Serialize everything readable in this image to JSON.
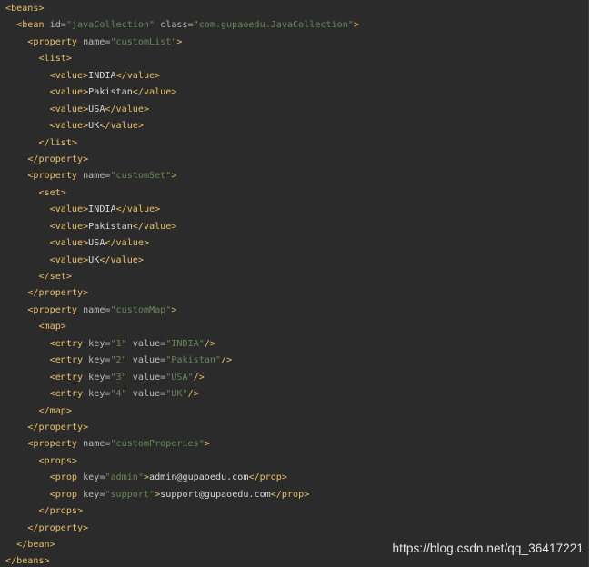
{
  "code_lines": [
    {
      "indent": 0,
      "tokens": [
        {
          "t": "tag",
          "v": "<beans>"
        }
      ]
    },
    {
      "indent": 1,
      "tokens": [
        {
          "t": "tag",
          "v": "<bean "
        },
        {
          "t": "attr",
          "v": "id="
        },
        {
          "t": "val",
          "v": "\"javaCollection\""
        },
        {
          "t": "attr",
          "v": " class="
        },
        {
          "t": "val",
          "v": "\"com.gupaoedu.JavaCollection\""
        },
        {
          "t": "tag",
          "v": ">"
        }
      ]
    },
    {
      "indent": 2,
      "tokens": [
        {
          "t": "tag",
          "v": "<property "
        },
        {
          "t": "attr",
          "v": "name="
        },
        {
          "t": "val",
          "v": "\"customList\""
        },
        {
          "t": "tag",
          "v": ">"
        }
      ]
    },
    {
      "indent": 3,
      "tokens": [
        {
          "t": "tag",
          "v": "<list>"
        }
      ]
    },
    {
      "indent": 4,
      "tokens": [
        {
          "t": "tag",
          "v": "<value>"
        },
        {
          "t": "txt",
          "v": "INDIA"
        },
        {
          "t": "tag",
          "v": "</value>"
        }
      ]
    },
    {
      "indent": 4,
      "tokens": [
        {
          "t": "tag",
          "v": "<value>"
        },
        {
          "t": "txt",
          "v": "Pakistan"
        },
        {
          "t": "tag",
          "v": "</value>"
        }
      ]
    },
    {
      "indent": 4,
      "tokens": [
        {
          "t": "tag",
          "v": "<value>"
        },
        {
          "t": "txt",
          "v": "USA"
        },
        {
          "t": "tag",
          "v": "</value>"
        }
      ]
    },
    {
      "indent": 4,
      "tokens": [
        {
          "t": "tag",
          "v": "<value>"
        },
        {
          "t": "txt",
          "v": "UK"
        },
        {
          "t": "tag",
          "v": "</value>"
        }
      ]
    },
    {
      "indent": 3,
      "tokens": [
        {
          "t": "tag",
          "v": "</list>"
        }
      ]
    },
    {
      "indent": 2,
      "tokens": [
        {
          "t": "tag",
          "v": "</property>"
        }
      ]
    },
    {
      "indent": 2,
      "tokens": [
        {
          "t": "tag",
          "v": "<property "
        },
        {
          "t": "attr",
          "v": "name="
        },
        {
          "t": "val",
          "v": "\"customSet\""
        },
        {
          "t": "tag",
          "v": ">"
        }
      ]
    },
    {
      "indent": 3,
      "tokens": [
        {
          "t": "tag",
          "v": "<set>"
        }
      ]
    },
    {
      "indent": 4,
      "tokens": [
        {
          "t": "tag",
          "v": "<value>"
        },
        {
          "t": "txt",
          "v": "INDIA"
        },
        {
          "t": "tag",
          "v": "</value>"
        }
      ]
    },
    {
      "indent": 4,
      "tokens": [
        {
          "t": "tag",
          "v": "<value>"
        },
        {
          "t": "txt",
          "v": "Pakistan"
        },
        {
          "t": "tag",
          "v": "</value>"
        }
      ]
    },
    {
      "indent": 4,
      "tokens": [
        {
          "t": "tag",
          "v": "<value>"
        },
        {
          "t": "txt",
          "v": "USA"
        },
        {
          "t": "tag",
          "v": "</value>"
        }
      ]
    },
    {
      "indent": 4,
      "tokens": [
        {
          "t": "tag",
          "v": "<value>"
        },
        {
          "t": "txt",
          "v": "UK"
        },
        {
          "t": "tag",
          "v": "</value>"
        }
      ]
    },
    {
      "indent": 3,
      "tokens": [
        {
          "t": "tag",
          "v": "</set>"
        }
      ]
    },
    {
      "indent": 2,
      "tokens": [
        {
          "t": "tag",
          "v": "</property>"
        }
      ]
    },
    {
      "indent": 2,
      "tokens": [
        {
          "t": "tag",
          "v": "<property "
        },
        {
          "t": "attr",
          "v": "name="
        },
        {
          "t": "val",
          "v": "\"customMap\""
        },
        {
          "t": "tag",
          "v": ">"
        }
      ]
    },
    {
      "indent": 3,
      "tokens": [
        {
          "t": "tag",
          "v": "<map>"
        }
      ]
    },
    {
      "indent": 4,
      "tokens": [
        {
          "t": "tag",
          "v": "<entry "
        },
        {
          "t": "attr",
          "v": "key="
        },
        {
          "t": "val",
          "v": "\"1\""
        },
        {
          "t": "attr",
          "v": " value="
        },
        {
          "t": "val",
          "v": "\"INDIA\""
        },
        {
          "t": "tag",
          "v": "/>"
        }
      ]
    },
    {
      "indent": 4,
      "tokens": [
        {
          "t": "tag",
          "v": "<entry "
        },
        {
          "t": "attr",
          "v": "key="
        },
        {
          "t": "val",
          "v": "\"2\""
        },
        {
          "t": "attr",
          "v": " value="
        },
        {
          "t": "val",
          "v": "\"Pakistan\""
        },
        {
          "t": "tag",
          "v": "/>"
        }
      ]
    },
    {
      "indent": 4,
      "tokens": [
        {
          "t": "tag",
          "v": "<entry "
        },
        {
          "t": "attr",
          "v": "key="
        },
        {
          "t": "val",
          "v": "\"3\""
        },
        {
          "t": "attr",
          "v": " value="
        },
        {
          "t": "val",
          "v": "\"USA\""
        },
        {
          "t": "tag",
          "v": "/>"
        }
      ]
    },
    {
      "indent": 4,
      "tokens": [
        {
          "t": "tag",
          "v": "<entry "
        },
        {
          "t": "attr",
          "v": "key="
        },
        {
          "t": "val",
          "v": "\"4\""
        },
        {
          "t": "attr",
          "v": " value="
        },
        {
          "t": "val",
          "v": "\"UK\""
        },
        {
          "t": "tag",
          "v": "/>"
        }
      ]
    },
    {
      "indent": 3,
      "tokens": [
        {
          "t": "tag",
          "v": "</map>"
        }
      ]
    },
    {
      "indent": 2,
      "tokens": [
        {
          "t": "tag",
          "v": "</property>"
        }
      ]
    },
    {
      "indent": 2,
      "tokens": [
        {
          "t": "tag",
          "v": "<property "
        },
        {
          "t": "attr",
          "v": "name="
        },
        {
          "t": "val",
          "v": "\"customProperies\""
        },
        {
          "t": "tag",
          "v": ">"
        }
      ]
    },
    {
      "indent": 3,
      "tokens": [
        {
          "t": "tag",
          "v": "<props>"
        }
      ]
    },
    {
      "indent": 4,
      "tokens": [
        {
          "t": "tag",
          "v": "<prop "
        },
        {
          "t": "attr",
          "v": "key="
        },
        {
          "t": "val",
          "v": "\"admin\""
        },
        {
          "t": "tag",
          "v": ">"
        },
        {
          "t": "txt",
          "v": "admin@gupaoedu.com"
        },
        {
          "t": "tag",
          "v": "</prop>"
        }
      ]
    },
    {
      "indent": 4,
      "tokens": [
        {
          "t": "tag",
          "v": "<prop "
        },
        {
          "t": "attr",
          "v": "key="
        },
        {
          "t": "val",
          "v": "\"support\""
        },
        {
          "t": "tag",
          "v": ">"
        },
        {
          "t": "txt",
          "v": "support@gupaoedu.com"
        },
        {
          "t": "tag",
          "v": "</prop>"
        }
      ]
    },
    {
      "indent": 3,
      "tokens": [
        {
          "t": "tag",
          "v": "</props>"
        }
      ]
    },
    {
      "indent": 2,
      "tokens": [
        {
          "t": "tag",
          "v": "</property>"
        }
      ]
    },
    {
      "indent": 1,
      "tokens": [
        {
          "t": "tag",
          "v": "</bean>"
        }
      ]
    },
    {
      "indent": 0,
      "tokens": [
        {
          "t": "tag",
          "v": "</beans>"
        }
      ]
    }
  ],
  "watermark": "https://blog.csdn.net/qq_36417221",
  "colors": {
    "background": "#2b2b2b",
    "tag": "#e8bf6a",
    "attribute": "#bababa",
    "attribute_value": "#6a8759",
    "text": "#d8d8d8"
  }
}
